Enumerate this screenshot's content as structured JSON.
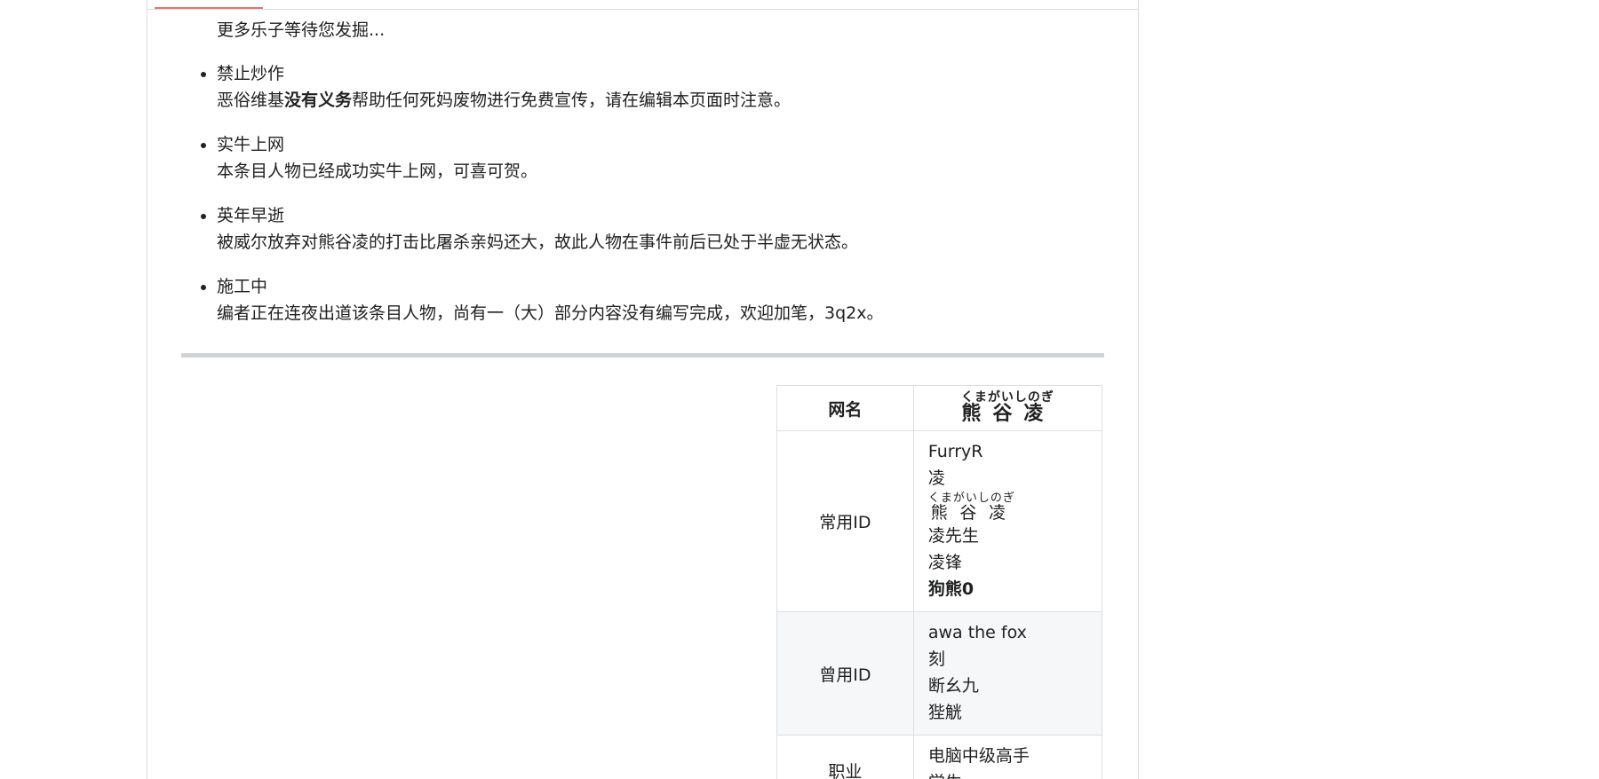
{
  "intro_tail": "更多乐子等待您发掘...",
  "notices": [
    {
      "title": "禁止炒作",
      "desc_prefix": "恶俗维基",
      "desc_bold": "没有义务",
      "desc_suffix": "帮助任何死妈废物进行免费宣传，请在编辑本页面时注意。"
    },
    {
      "title": "实牛上网",
      "desc": "本条目人物已经成功实牛上网，可喜可贺。"
    },
    {
      "title": "英年早逝",
      "desc": "被威尔放弃对熊谷凌的打击比屠杀亲妈还大，故此人物在事件前后已处于半虚无状态。"
    },
    {
      "title": "施工中",
      "desc": "编者正在连夜出道该条目人物，尚有一（大）部分内容没有编写完成，欢迎加笔，3q2x。"
    }
  ],
  "infobox": {
    "header_label": "网名",
    "header_name": "熊谷凌",
    "header_ruby": "くまがいしのぎ",
    "rows": [
      {
        "label": "常用ID",
        "values": {
          "v1": "FurryR",
          "v2": "凌",
          "v3_ruby_base": "熊谷凌",
          "v3_ruby_text": "くまがいしのぎ",
          "v4": "凌先生",
          "v5": "凌锋",
          "v6": "狗熊0"
        }
      },
      {
        "label": "曾用ID",
        "values": {
          "v1": "awa the fox",
          "v2": "刻",
          "v3": "断幺九",
          "v4": "狴觥"
        }
      },
      {
        "label": "职业",
        "values": {
          "v1": "电脑中级高手",
          "v2": "学生"
        }
      }
    ]
  }
}
